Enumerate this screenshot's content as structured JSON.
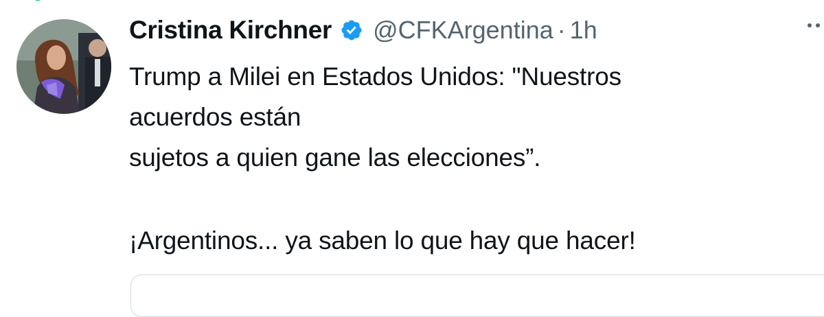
{
  "tweet": {
    "display_name": "Cristina Kirchner",
    "handle": "@CFKArgentina",
    "separator": "·",
    "timestamp": "1h",
    "text_lines": [
      "Trump a Milei en Estados Unidos: \"Nuestros",
      "acuerdos están",
      "sujetos a quien gane las elecciones”.",
      "¡Argentinos... ya saben lo que hay que hacer!"
    ]
  },
  "icons": {
    "verified": "verified-badge-icon",
    "more": "more-options-icon",
    "avatar": "profile-avatar"
  },
  "colors": {
    "text": "#0f1419",
    "secondary_text": "#536471",
    "verified_blue": "#1d9bf0",
    "border": "#cfd9de"
  }
}
